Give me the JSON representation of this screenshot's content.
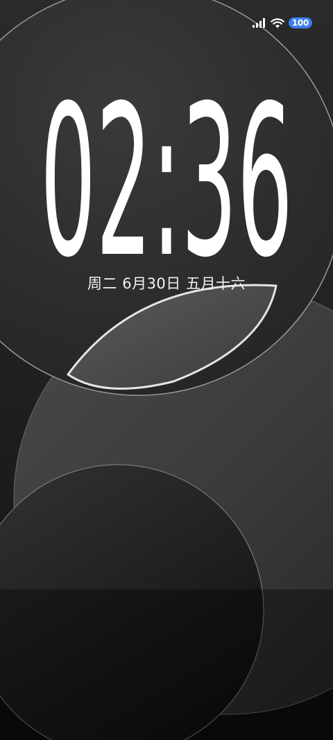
{
  "status_bar": {
    "battery_level": "100",
    "signal_icon": "signal-bars-icon",
    "wifi_icon": "wifi-icon",
    "accent_color": "#3b7ded"
  },
  "lock_screen": {
    "time": {
      "hours": "02",
      "separator": ":",
      "minutes": "36"
    },
    "date": {
      "weekday": "周二",
      "solar_date": "6月30日",
      "lunar_date": "五月十六"
    }
  }
}
